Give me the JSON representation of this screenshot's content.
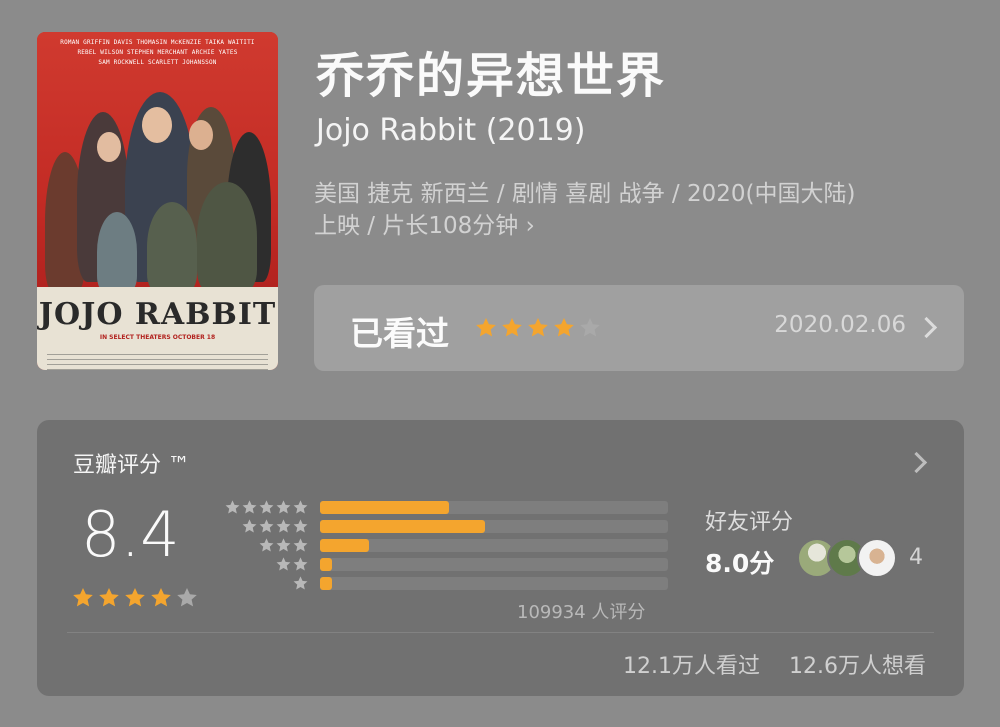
{
  "poster": {
    "credits": [
      "ROMAN GRIFFIN DAVIS  THOMASIN McKENZIE  TAIKA WAITITI",
      "REBEL WILSON   STEPHEN MERCHANT   ARCHIE YATES",
      "SAM ROCKWELL   SCARLETT JOHANSSON"
    ],
    "title": "JOJO RABBIT",
    "tagline": "IN SELECT THEATERS OCTOBER 18"
  },
  "movie": {
    "title_cn": "乔乔的异想世界",
    "title_en": "Jojo Rabbit (2019)",
    "meta_line1": "美国 捷克 新西兰 / 剧情 喜剧 战争 / 2020(中国大陆)",
    "meta_line2": "上映 / 片长108分钟 ›"
  },
  "watched": {
    "label": "已看过",
    "user_rating": 4,
    "max_rating": 5,
    "date": "2020.02.06"
  },
  "douban": {
    "header": "豆瓣评分 ™",
    "score": "8.4",
    "score_stars": 4,
    "distribution": [
      {
        "stars": 5,
        "fraction": 0.37
      },
      {
        "stars": 4,
        "fraction": 0.475
      },
      {
        "stars": 3,
        "fraction": 0.14
      },
      {
        "stars": 2,
        "fraction": 0.035
      },
      {
        "stars": 1,
        "fraction": 0.035
      }
    ],
    "rating_count": "109934 人评分",
    "friends_label": "好友评分",
    "friends_score": "8.0分",
    "friends_count": "4",
    "watched_count": "12.1万人看过",
    "want_count": "12.6万人想看"
  },
  "colors": {
    "star_on": "#f4a52e",
    "star_off": "#a9a9a9",
    "rating_star": "#b8b8b8"
  }
}
